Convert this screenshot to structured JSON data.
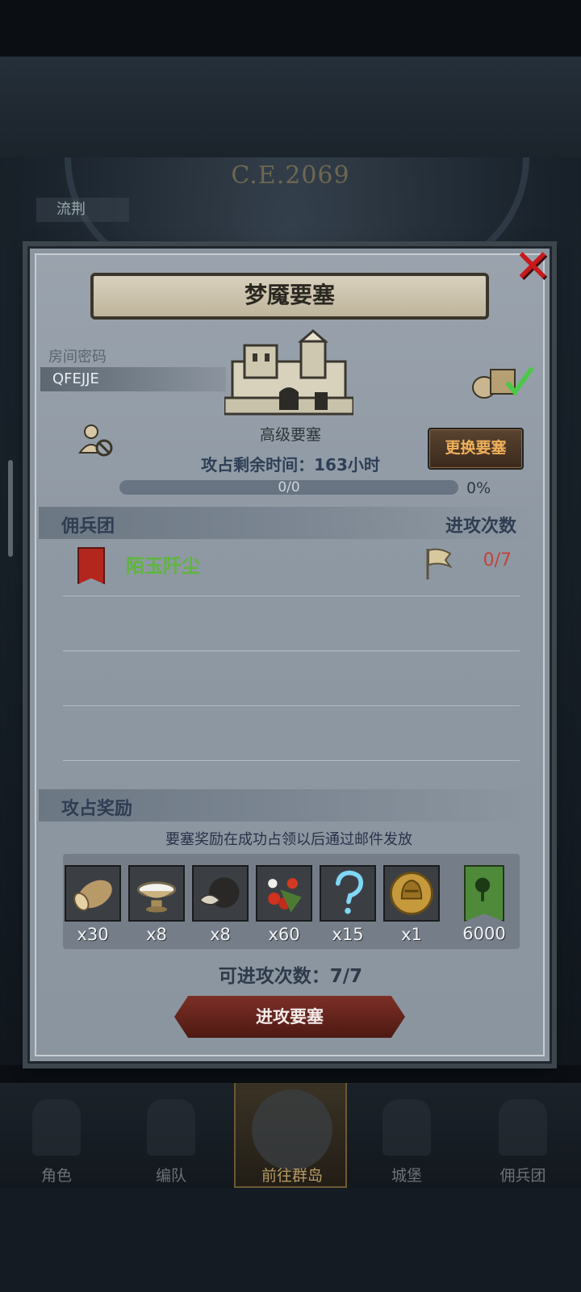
{
  "background": {
    "era_label": "C.E.2069",
    "hud_left_label": "流荆"
  },
  "dialog": {
    "title": "梦魇要塞",
    "room_label": "房间密码",
    "room_code": "QFEJJE",
    "fortress_level": "高级要塞",
    "remaining_time": "攻占剩余时间：163小时",
    "progress_text": "0/0",
    "progress_fraction": 0,
    "progress_percent": "0%",
    "change_button": "更换要塞",
    "legion_header": "佣兵团",
    "attack_header": "进攻次数",
    "legions": [
      {
        "name": "陌玉阡尘",
        "attacks": "0/7",
        "color": "#5fb53e"
      }
    ],
    "reward_header": "攻占奖励",
    "reward_note": "要塞奖励在成功占领以后通过邮件发放",
    "rewards": [
      {
        "icon": "wood-log-icon",
        "qty": "x30"
      },
      {
        "icon": "milk-bowl-icon",
        "qty": "x8"
      },
      {
        "icon": "truffle-icon",
        "qty": "x8"
      },
      {
        "icon": "berries-icon",
        "qty": "x60"
      },
      {
        "icon": "mystery-question-icon",
        "qty": "x15"
      },
      {
        "icon": "gold-helmet-coin-icon",
        "qty": "x1"
      },
      {
        "icon": "legion-banner-icon",
        "qty": "6000"
      }
    ],
    "attacks_available": "可进攻次数：7/7",
    "attack_button": "进攻要塞"
  },
  "bottom_nav": [
    {
      "label": "角色"
    },
    {
      "label": "编队"
    },
    {
      "label": "前往群岛",
      "active": true
    },
    {
      "label": "城堡"
    },
    {
      "label": "佣兵团"
    }
  ]
}
